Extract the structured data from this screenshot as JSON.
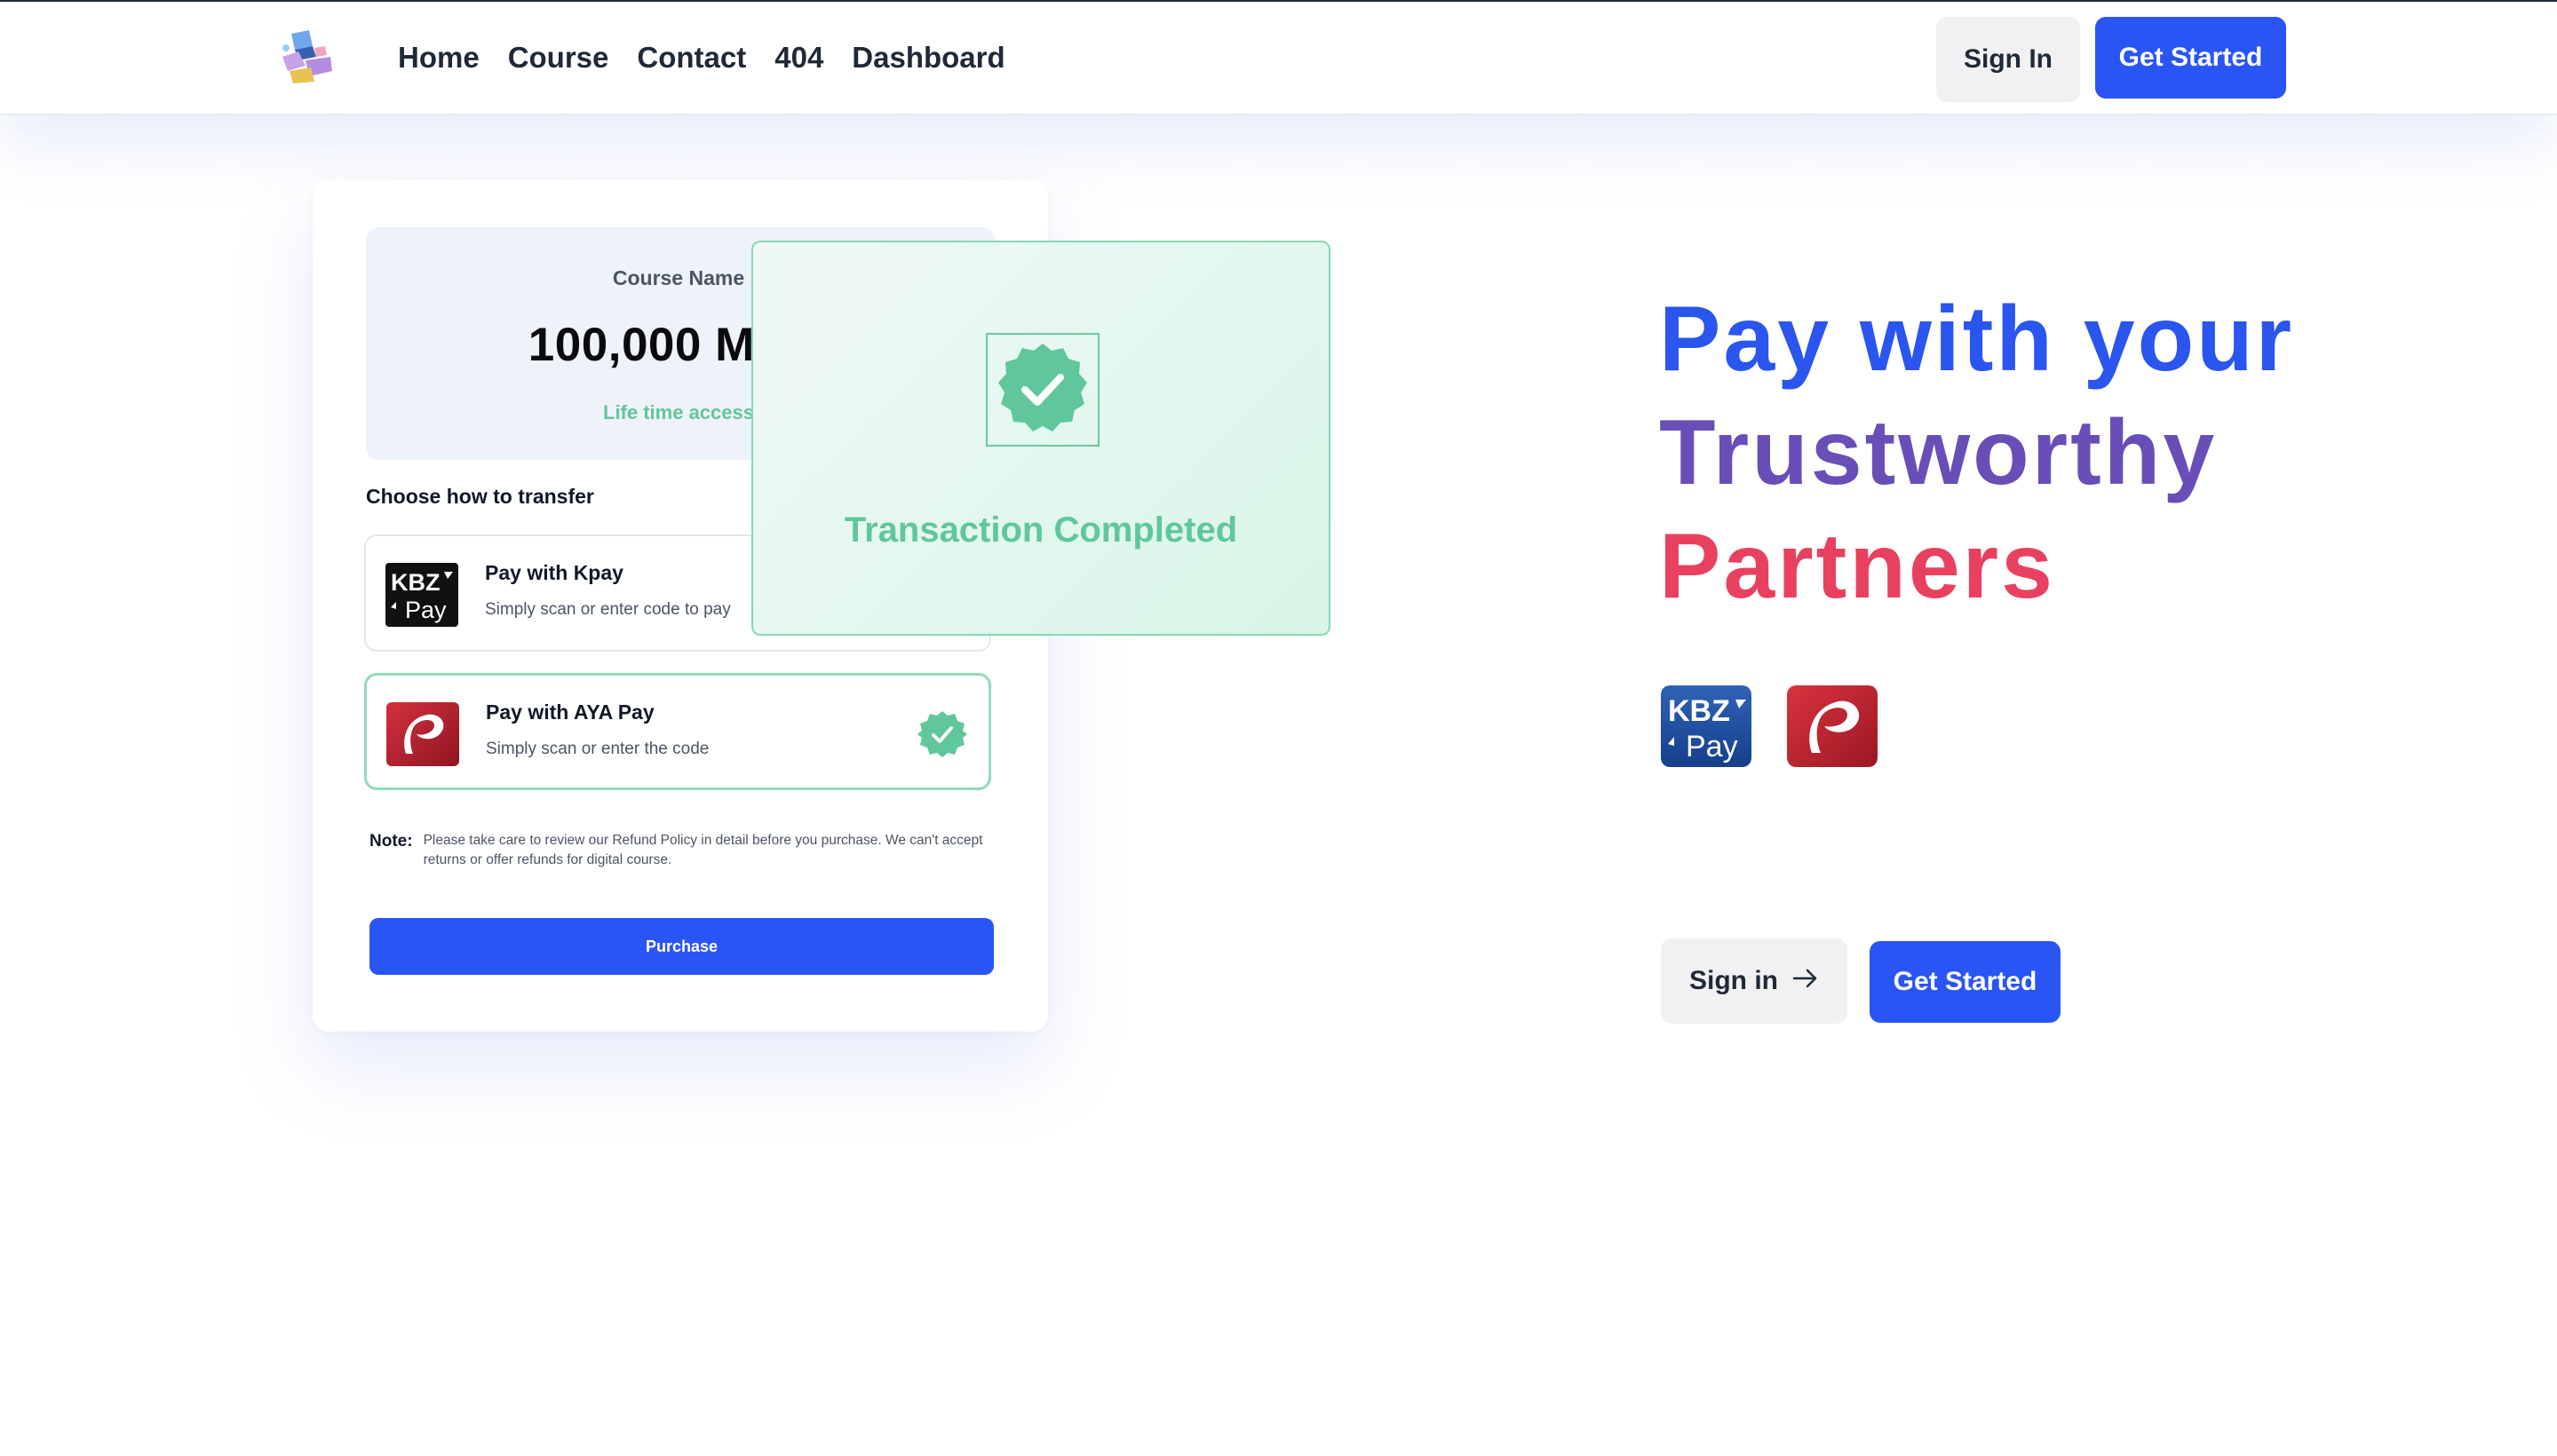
{
  "nav": {
    "links": [
      "Home",
      "Course",
      "Contact",
      "404",
      "Dashboard"
    ],
    "sign_in": "Sign In",
    "get_started": "Get Started"
  },
  "checkout": {
    "course_name": "Course Name",
    "price": "100,000 MMK",
    "lifetime": "Life time access",
    "choose_label": "Choose how to transfer",
    "options": [
      {
        "title": "Pay with Kpay",
        "desc": "Simply scan or enter code to pay",
        "logo": "kbzpay-logo",
        "selected": false
      },
      {
        "title": "Pay with AYA Pay",
        "desc": "Simply scan or enter the code",
        "logo": "ayapay-logo",
        "selected": true
      }
    ],
    "note_label": "Note:",
    "note_text": "Please take care to review our Refund Policy in detail before you purchase. We can't accept returns or offer refunds for digital course.",
    "purchase": "Purchase"
  },
  "transaction": {
    "label": "Transaction Completed",
    "icon": "check-badge-icon"
  },
  "hero": {
    "line1": "Pay with your",
    "line2": "Trustworthy",
    "line3": "Partners",
    "sign_in": "Sign in",
    "get_started": "Get Started"
  },
  "colors": {
    "primary": "#2a55f5",
    "blue_text": "#2a55ef",
    "purple_text": "#6a4eb8",
    "red_text": "#e8415f",
    "success": "#5fc79b"
  }
}
